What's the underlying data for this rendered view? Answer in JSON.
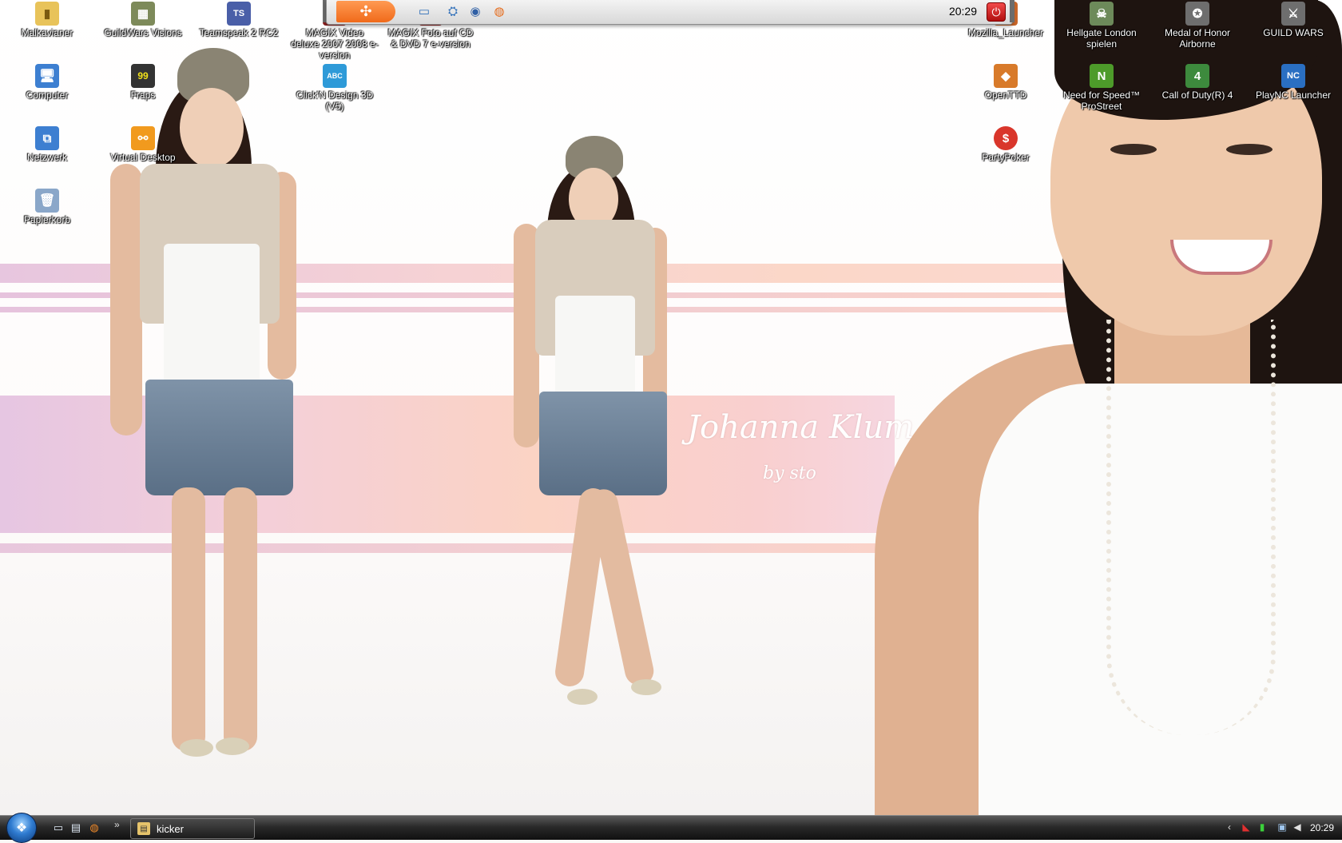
{
  "wallpaper": {
    "signature": "Johanna Klum",
    "signature_by": "by sto"
  },
  "desktop_icons": [
    {
      "id": "malkavianer",
      "label": "Malkavianer",
      "glyph": "▮",
      "color": "#e8c35a"
    },
    {
      "id": "guildwars-visions",
      "label": "GuildWars Visions",
      "glyph": "▦",
      "color": "#7d8a5a"
    },
    {
      "id": "teamspeak",
      "label": "Teamspeak 2 RC2",
      "glyph": "TS",
      "color": "#4a5fa8"
    },
    {
      "id": "magix-video",
      "label": "MAGIX Video deluxe 2007 2008 e-version",
      "glyph": "M",
      "color": "#8a2020"
    },
    {
      "id": "magix-foto",
      "label": "MAGIX Foto auf CD & DVD 7 e-version",
      "glyph": "M",
      "color": "#8a2020"
    },
    {
      "id": "computer",
      "label": "Computer",
      "glyph": "🖥",
      "color": "#3d7fd1"
    },
    {
      "id": "fraps",
      "label": "Fraps",
      "glyph": "99",
      "color": "#333333"
    },
    {
      "id": "clickndesign",
      "label": "Click'N Design 3D (V5)",
      "glyph": "ABC",
      "color": "#2e9ad8"
    },
    {
      "id": "netzwerk",
      "label": "Netzwerk",
      "glyph": "⧉",
      "color": "#3d7fd1"
    },
    {
      "id": "virtual-desktop",
      "label": "Virtual Desktop",
      "glyph": "⚯",
      "color": "#f19a1e"
    },
    {
      "id": "papierkorb",
      "label": "Papierkorb",
      "glyph": "🗑",
      "color": "#8aa7c9"
    },
    {
      "id": "mozilla-launcher",
      "label": "Mozilla_Launcher",
      "glyph": "◐",
      "color": "#c8662a"
    },
    {
      "id": "hellgate",
      "label": "Hellgate London spielen",
      "glyph": "☠",
      "color": "#6d8a5a"
    },
    {
      "id": "medal-of-honor",
      "label": "Medal of Honor Airborne",
      "glyph": "✪",
      "color": "#6e6e6e"
    },
    {
      "id": "guild-wars",
      "label": "GUILD WARS",
      "glyph": "⚔",
      "color": "#6e6e6e"
    },
    {
      "id": "openttd",
      "label": "OpenTTD",
      "glyph": "◆",
      "color": "#d87a2a"
    },
    {
      "id": "nfs-prostreet",
      "label": "Need for Speed™ ProStreet",
      "glyph": "N",
      "color": "#4d9b2a"
    },
    {
      "id": "cod4",
      "label": "Call of Duty(R) 4",
      "glyph": "4",
      "color": "#3d8a3d"
    },
    {
      "id": "plaync",
      "label": "PlayNC Launcher",
      "glyph": "NC",
      "color": "#2a6fc2"
    },
    {
      "id": "partypoker",
      "label": "PartyPoker",
      "glyph": "$",
      "color": "#d9362b"
    }
  ],
  "dock": {
    "start_glyph": "✣",
    "buttons": [
      {
        "id": "show-desktop",
        "glyph": "▭",
        "color": "#2f6fb9"
      },
      {
        "id": "network",
        "glyph": "⛭",
        "color": "#2f6fb9"
      },
      {
        "id": "thunderbird",
        "glyph": "◉",
        "color": "#2f5fa5"
      },
      {
        "id": "firefox",
        "glyph": "◍",
        "color": "#e56a1a"
      }
    ],
    "clock": "20:29",
    "power_glyph": "⏻"
  },
  "taskbar": {
    "start_glyph": "❖",
    "quick_launch": [
      {
        "id": "show-desktop",
        "glyph": "▭"
      },
      {
        "id": "switch-windows",
        "glyph": "▤"
      },
      {
        "id": "firefox",
        "glyph": "◍"
      }
    ],
    "more_glyph": "»",
    "task_buttons": [
      {
        "id": "kicker",
        "label": "kicker",
        "glyph": "▤"
      }
    ],
    "tray_arrow": "‹",
    "tray_icons": [
      {
        "id": "antivirus",
        "glyph": "◣",
        "color": "#e03030"
      },
      {
        "id": "meter",
        "glyph": "▮",
        "color": "#3bd03b"
      },
      {
        "id": "network-tray",
        "glyph": "▣",
        "color": "#9fc6ee"
      },
      {
        "id": "volume",
        "glyph": "◀",
        "color": "#e0e0e0"
      }
    ],
    "clock": "20:29"
  }
}
